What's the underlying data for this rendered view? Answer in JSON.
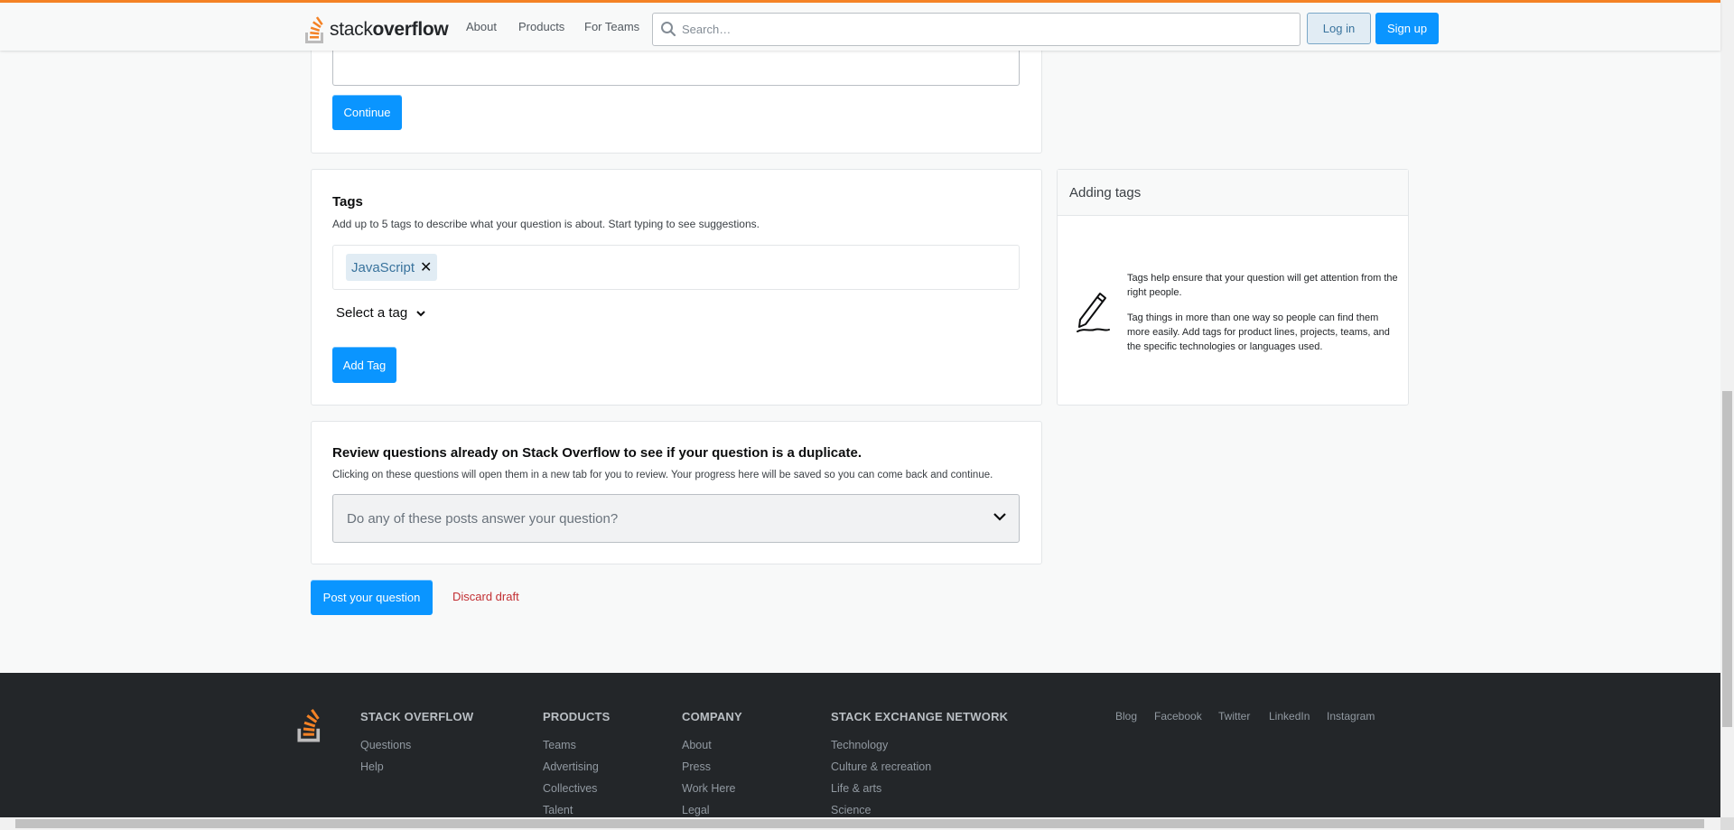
{
  "header": {
    "logo_word_light": "stack",
    "logo_word_bold": "overflow",
    "nav": [
      "About",
      "Products",
      "For Teams"
    ],
    "search_placeholder": "Search…",
    "login_label": "Log in",
    "signup_label": "Sign up",
    "accent_color": "#f48225"
  },
  "body_section": {
    "continue_label": "Continue"
  },
  "tags_section": {
    "title": "Tags",
    "description": "Add up to 5 tags to describe what your question is about. Start typing to see suggestions.",
    "tags": [
      "JavaScript"
    ],
    "remove_glyph": "✕",
    "select_label": "Select a tag",
    "add_tag_label": "Add Tag"
  },
  "sidebar": {
    "title": "Adding tags",
    "paragraph_1": "Tags help ensure that your question will get attention from the right people.",
    "paragraph_2": "Tag things in more than one way so people can find them more easily. Add tags for product lines, projects, teams, and the specific technologies or languages used."
  },
  "duplicate_section": {
    "title": "Review questions already on Stack Overflow to see if your question is a duplicate.",
    "description": "Clicking on these questions will open them in a new tab for you to review. Your progress here will be saved so you can come back and continue.",
    "select_placeholder": "Do any of these posts answer your question?"
  },
  "actions": {
    "post_label": "Post your question",
    "discard_label": "Discard draft"
  },
  "footer": {
    "columns": [
      {
        "heading": "STACK OVERFLOW",
        "links": [
          "Questions",
          "Help"
        ]
      },
      {
        "heading": "PRODUCTS",
        "links": [
          "Teams",
          "Advertising",
          "Collectives",
          "Talent"
        ]
      },
      {
        "heading": "COMPANY",
        "links": [
          "About",
          "Press",
          "Work Here",
          "Legal"
        ]
      },
      {
        "heading": "STACK EXCHANGE NETWORK",
        "links": [
          "Technology",
          "Culture & recreation",
          "Life & arts",
          "Science"
        ]
      }
    ],
    "social": [
      "Blog",
      "Facebook",
      "Twitter",
      "LinkedIn",
      "Instagram"
    ]
  }
}
